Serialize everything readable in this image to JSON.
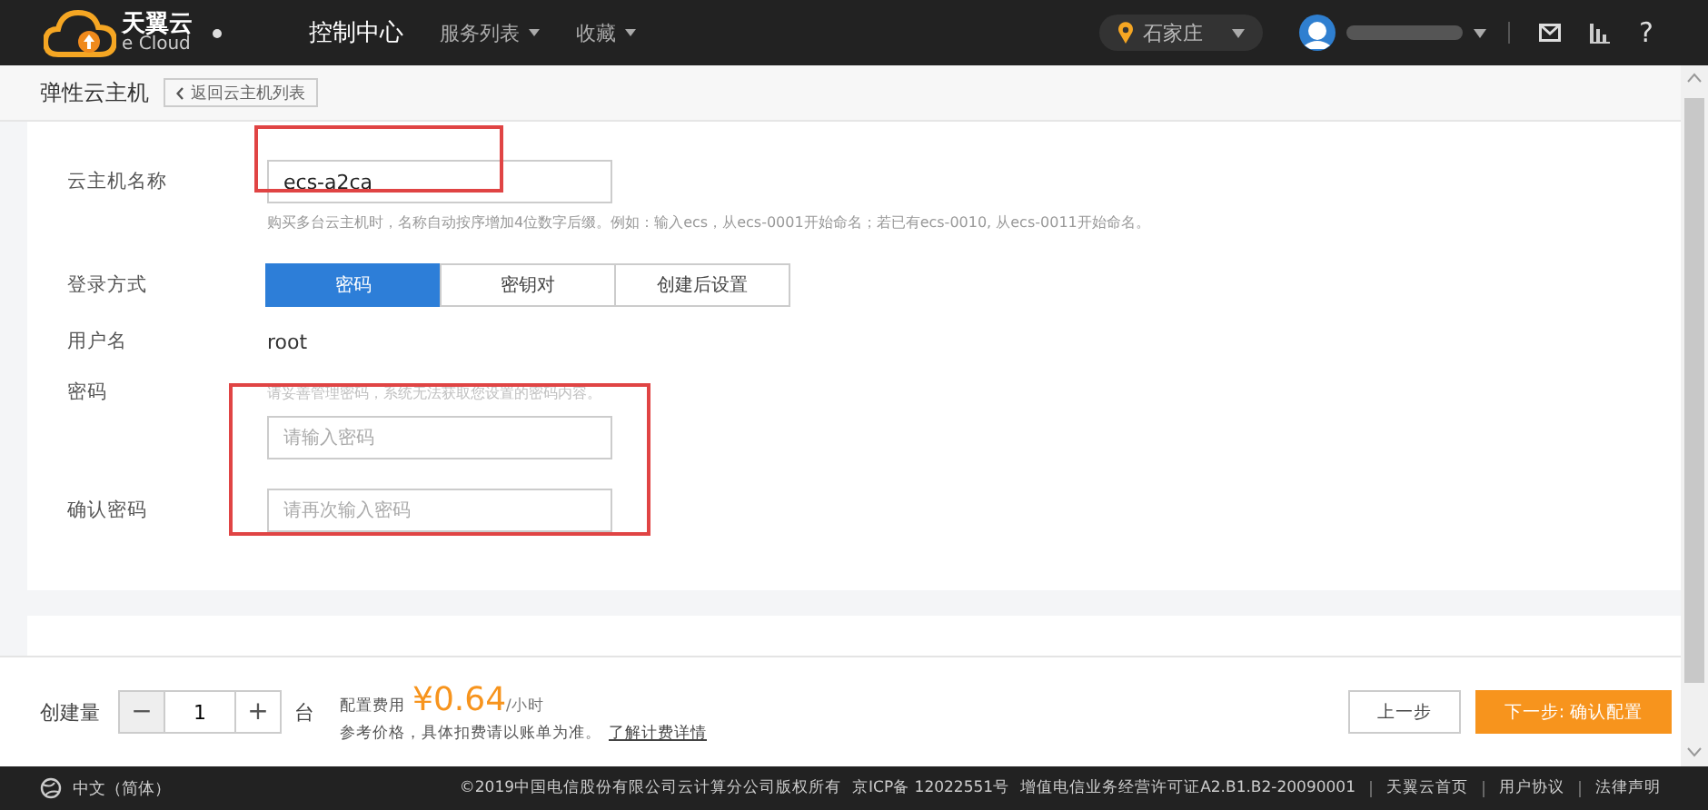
{
  "header": {
    "logo_text": "天翼云",
    "logo_sub": "e Cloud",
    "nav": [
      {
        "label": "控制中心",
        "selected": true,
        "dropdown": false
      },
      {
        "label": "服务列表",
        "selected": false,
        "dropdown": true
      },
      {
        "label": "收藏",
        "selected": false,
        "dropdown": true
      }
    ],
    "region": "石家庄",
    "help": "?"
  },
  "page": {
    "title": "弹性云主机",
    "back_link": "返回云主机列表"
  },
  "form": {
    "name": {
      "label": "云主机名称",
      "value": "ecs-a2ca",
      "hint": "购买多台云主机时，名称自动按序增加4位数字后缀。例如：输入ecs，从ecs-0001开始命名；若已有ecs-0010, 从ecs-0011开始命名。"
    },
    "login": {
      "label": "登录方式",
      "options": [
        {
          "label": "密码",
          "selected": true
        },
        {
          "label": "密钥对",
          "selected": false
        },
        {
          "label": "创建后设置",
          "selected": false
        }
      ]
    },
    "username": {
      "label": "用户名",
      "value": "root"
    },
    "password": {
      "label": "密码",
      "hint": "请妥善管理密码，系统无法获取您设置的密码内容。",
      "placeholder": "请输入密码"
    },
    "confirm": {
      "label": "确认密码",
      "placeholder": "请再次输入密码"
    }
  },
  "order": {
    "quantity_label": "创建量",
    "minus": "−",
    "quantity": "1",
    "plus": "+",
    "unit": "台",
    "fee_label": "配置费用",
    "price": "¥0.64",
    "price_unit": "/小时",
    "note": "参考价格，具体扣费请以账单为准。",
    "link": "了解计费详情",
    "buttons": [
      {
        "label": "上一步",
        "kind": "secondary"
      },
      {
        "label": "下一步: 确认配置",
        "kind": "primary"
      }
    ]
  },
  "footer": {
    "language": "中文（简体）",
    "copyright": "©2019中国电信股份有限公司云计算分公司版权所有",
    "icp": "京ICP备 12022551号",
    "license": "增值电信业务经营许可证A2.B1.B2-20090001",
    "links": [
      "天翼云首页",
      "用户协议",
      "法律声明"
    ]
  }
}
